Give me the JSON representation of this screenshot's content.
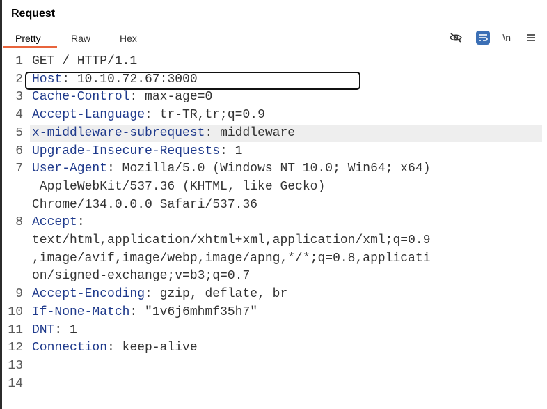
{
  "panel": {
    "title": "Request",
    "tabs": [
      {
        "label": "Pretty",
        "active": true
      },
      {
        "label": "Raw",
        "active": false
      },
      {
        "label": "Hex",
        "active": false
      }
    ],
    "toolbar": {
      "icons": [
        "eye-off-icon",
        "wrap-icon",
        "newline-toggle",
        "menu-icon"
      ],
      "newline_label": "\\n",
      "accent": "#e8643c",
      "wrap_bg": "#3b6fb5"
    }
  },
  "editor": {
    "highlighted_line": 5,
    "lines": [
      {
        "n": "1",
        "header": "",
        "sep": "",
        "value": "GET / HTTP/1.1"
      },
      {
        "n": "2",
        "header": "Host",
        "sep": ": ",
        "value": "10.10.72.67:3000"
      },
      {
        "n": "3",
        "header": "Cache-Control",
        "sep": ": ",
        "value": "max-age=0"
      },
      {
        "n": "4",
        "header": "Accept-Language",
        "sep": ": ",
        "value": "tr-TR,tr;q=0.9"
      },
      {
        "n": "5",
        "header": "x-middleware-subrequest",
        "sep": ": ",
        "value": "middleware"
      },
      {
        "n": "6",
        "header": "Upgrade-Insecure-Requests",
        "sep": ": ",
        "value": "1"
      },
      {
        "n": "7",
        "header": "User-Agent",
        "sep": ": ",
        "value": "Mozilla/5.0 (Windows NT 10.0; Win64; x64)"
      },
      {
        "n": "",
        "header": "",
        "sep": "",
        "value": " AppleWebKit/537.36 (KHTML, like Gecko)"
      },
      {
        "n": "",
        "header": "",
        "sep": "",
        "value": "Chrome/134.0.0.0 Safari/537.36"
      },
      {
        "n": "8",
        "header": "Accept",
        "sep": ":",
        "value": ""
      },
      {
        "n": "",
        "header": "",
        "sep": "",
        "value": "text/html,application/xhtml+xml,application/xml;q=0.9"
      },
      {
        "n": "",
        "header": "",
        "sep": "",
        "value": ",image/avif,image/webp,image/apng,*/*;q=0.8,applicati"
      },
      {
        "n": "",
        "header": "",
        "sep": "",
        "value": "on/signed-exchange;v=b3;q=0.7"
      },
      {
        "n": "9",
        "header": "Accept-Encoding",
        "sep": ": ",
        "value": "gzip, deflate, br"
      },
      {
        "n": "10",
        "header": "If-None-Match",
        "sep": ": ",
        "value": "\"1v6j6mhmf35h7\""
      },
      {
        "n": "11",
        "header": "DNT",
        "sep": ": ",
        "value": "1"
      },
      {
        "n": "12",
        "header": "Connection",
        "sep": ": ",
        "value": "keep-alive"
      },
      {
        "n": "13",
        "header": "",
        "sep": "",
        "value": ""
      },
      {
        "n": "14",
        "header": "",
        "sep": "",
        "value": ""
      }
    ]
  }
}
